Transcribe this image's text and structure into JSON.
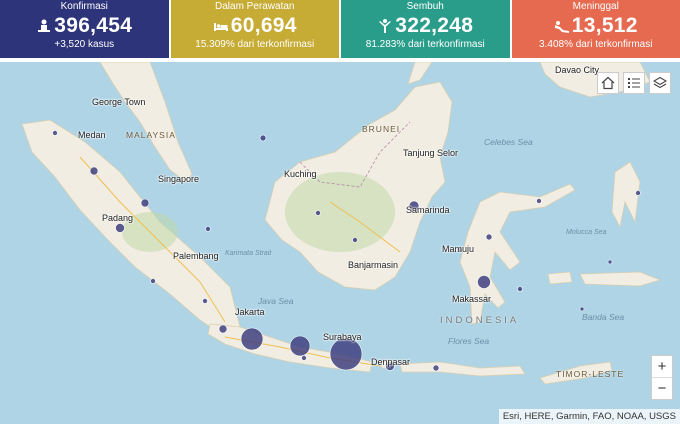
{
  "stats": [
    {
      "label": "Konfirmasi",
      "value": "396,454",
      "sub": "+3,520 kasus",
      "color": "#2e3479",
      "icon": "patient-icon"
    },
    {
      "label": "Dalam Perawatan",
      "value": "60,694",
      "sub": "15.309% dari terkonfirmasi",
      "color": "#c6ab34",
      "icon": "hospital-bed-icon"
    },
    {
      "label": "Sembuh",
      "value": "322,248",
      "sub": "81.283% dari terkonfirmasi",
      "color": "#2a9d8a",
      "icon": "recovered-icon"
    },
    {
      "label": "Meninggal",
      "value": "13,512",
      "sub": "3.408% dari terkonfirmasi",
      "color": "#e56a50",
      "icon": "deceased-icon"
    }
  ],
  "map": {
    "countries": [
      "MALAYSIA",
      "BRUNEI",
      "TIMOR-LESTE"
    ],
    "country_main": "INDONESIA",
    "cities": [
      "Davao City",
      "George Town",
      "Medan",
      "Singapore",
      "Padang",
      "Palembang",
      "Jakarta",
      "Kuching",
      "Samarinda",
      "Tanjung Selor",
      "Banjarmasin",
      "Surabaya",
      "Denpasar",
      "Mamuju",
      "Makassar"
    ],
    "seas": [
      "Celebes Sea",
      "Karimata Strait",
      "Java Sea",
      "Flores Sea",
      "Banda Sea",
      "Molucca Sea"
    ],
    "attribution": "Esri, HERE, Garmin, FAO, NOAA, USGS",
    "zoom_in": "+",
    "zoom_out": "−",
    "bubble_color": "#3f3f7f"
  }
}
